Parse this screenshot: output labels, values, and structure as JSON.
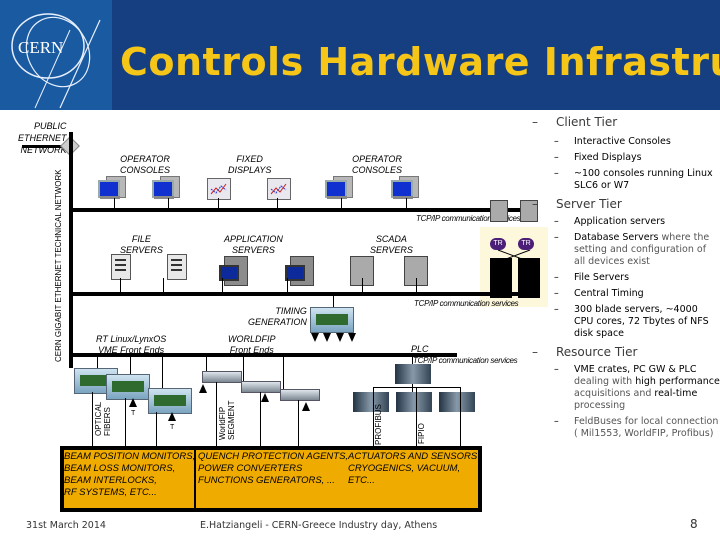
{
  "header": {
    "logo_text": "CERN",
    "title": "Controls Hardware Infrastructure",
    "colors": {
      "background": "#163f82",
      "title": "#f5c518",
      "logo_bg": "#1a5aa0"
    }
  },
  "diagram": {
    "public_network": [
      "PUBLIC",
      "ETHERNET",
      "NETWORK"
    ],
    "backbone_label": "CERN GIGABIT ETHERNET TECHNICAL NETWORK",
    "client_row": {
      "operator_consoles_1": [
        "OPERATOR",
        "CONSOLES"
      ],
      "fixed_displays": [
        "FIXED",
        "DISPLAYS"
      ],
      "operator_consoles_2": [
        "OPERATOR",
        "CONSOLES"
      ]
    },
    "tcp_label_1": "TCP/IP communication services",
    "server_row": {
      "file_servers": [
        "FILE",
        "SERVERS"
      ],
      "application_servers": [
        "APPLICATION",
        "SERVERS"
      ],
      "scada_servers": [
        "SCADA",
        "SERVERS"
      ],
      "tr_label": "TR"
    },
    "tcp_label_2": "TCP/IP communication services",
    "timing": [
      "TIMING",
      "GENERATION"
    ],
    "front_ends": {
      "vme": [
        "RT Linux/LynxOS",
        "VME Front Ends"
      ],
      "worldfip": [
        "WORLDFIP",
        "Front Ends"
      ],
      "plc": "PLC"
    },
    "tcp_label_3": "TCP/IP communication services",
    "segments": {
      "optical": [
        "OPTICAL",
        "FIBERS"
      ],
      "worldfip": [
        "WorldFIP",
        "SEGMENT"
      ],
      "profibus": "PROFIBUS",
      "fipio": "FIPIO",
      "timing_marker": "T"
    },
    "equipment_box": {
      "col1": [
        "BEAM POSITION MONITORS,",
        "BEAM LOSS MONITORS,",
        "BEAM INTERLOCKS,",
        "RF SYSTEMS, ETC..."
      ],
      "col2": [
        "QUENCH PROTECTION AGENTS,",
        "POWER CONVERTERS",
        "FUNCTIONS GENERATORS, ..."
      ],
      "col3": [
        "ACTUATORS AND SENSORS",
        "CRYOGENICS, VACUUM,",
        "ETC..."
      ],
      "color": "#f0ab00"
    }
  },
  "bullets": {
    "client_tier": {
      "title": "Client Tier",
      "items": [
        "Interactive Consoles",
        "Fixed Displays",
        "~100 consoles running Linux SLC6 or W7"
      ]
    },
    "server_tier": {
      "title": "Server Tier",
      "items": [
        {
          "strong": "Application servers",
          "rest": ""
        },
        {
          "strong": "Database Servers",
          "rest": " where the setting and configuration of all devices exist"
        },
        {
          "strong": "File Servers",
          "rest": ""
        },
        {
          "strong": "Central Timing",
          "rest": ""
        },
        {
          "strong": "300 blade servers, ~4000 CPU cores, 72 Tbytes of NFS disk space",
          "rest": ""
        }
      ]
    },
    "resource_tier": {
      "title": "Resource Tier",
      "item1": {
        "a": "VME crates, PC GW & PLC",
        "b": " dealing with ",
        "c": "high performance",
        "d": " acquisitions and ",
        "e": "real-time",
        "f": " processing"
      },
      "item2": "FeldBuses for local connection ( Mil1553, WorldFIP, Profibus)"
    }
  },
  "footer": {
    "date": "31st March 2014",
    "author": "E.Hatziangeli - CERN-Greece Industry day, Athens",
    "page": "8"
  }
}
